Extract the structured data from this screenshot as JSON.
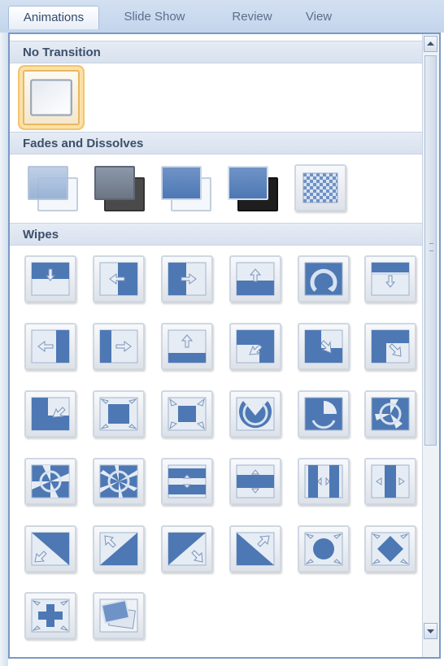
{
  "tabs": [
    {
      "label": "Animations",
      "active": true
    },
    {
      "label": "Slide Show",
      "active": false
    },
    {
      "label": "Review",
      "active": false
    },
    {
      "label": "View",
      "active": false
    }
  ],
  "sections": {
    "no_transition": "No Transition",
    "fades": "Fades and Dissolves",
    "wipes": "Wipes"
  },
  "colors": {
    "accent_blue": "#4d78b4",
    "selection": "#f3c46e",
    "panel_border": "#7a9ac3"
  },
  "scrollbar": {
    "up_icon": "scroll-up-arrow",
    "down_icon": "scroll-down-arrow"
  }
}
